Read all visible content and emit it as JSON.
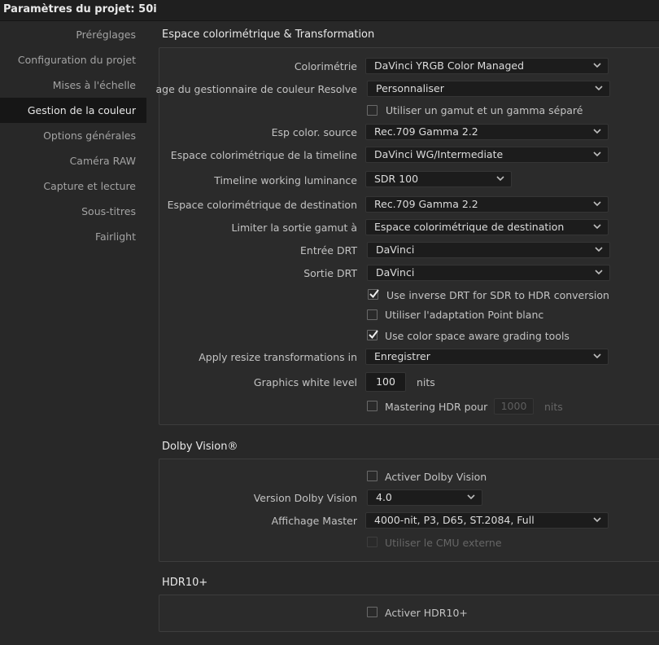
{
  "window": {
    "title": "Paramètres du projet:  50i"
  },
  "sidebar": {
    "items": [
      {
        "label": "Préréglages"
      },
      {
        "label": "Configuration du projet"
      },
      {
        "label": "Mises à l'échelle"
      },
      {
        "label": "Gestion de la couleur"
      },
      {
        "label": "Options générales"
      },
      {
        "label": "Caméra RAW"
      },
      {
        "label": "Capture et lecture"
      },
      {
        "label": "Sous-titres"
      },
      {
        "label": "Fairlight"
      }
    ],
    "active_index": 3
  },
  "color_section": {
    "title": "Espace colorimétrique & Transformation",
    "colorimetrie": {
      "label": "Colorimétrie",
      "value": "DaVinci YRGB Color Managed"
    },
    "preset": {
      "label": "age du gestionnaire de couleur Resolve",
      "value": "Personnaliser"
    },
    "separate_gamut": {
      "label": "Utiliser un gamut et un gamma séparé",
      "checked": false
    },
    "input_space": {
      "label": "Esp color. source",
      "value": "Rec.709 Gamma 2.2"
    },
    "timeline_space": {
      "label": "Espace colorimétrique de la timeline",
      "value": "DaVinci WG/Intermediate"
    },
    "timeline_luminance": {
      "label": "Timeline working luminance",
      "value": "SDR 100"
    },
    "output_space": {
      "label": "Espace colorimétrique de destination",
      "value": "Rec.709 Gamma 2.2"
    },
    "limit_gamut": {
      "label": "Limiter la sortie gamut à",
      "value": "Espace colorimétrique de destination"
    },
    "input_drt": {
      "label": "Entrée DRT",
      "value": "DaVinci"
    },
    "output_drt": {
      "label": "Sortie DRT",
      "value": "DaVinci"
    },
    "inverse_drt": {
      "label": "Use inverse DRT for SDR to HDR conversion",
      "checked": true
    },
    "white_point": {
      "label": "Utiliser l'adaptation Point blanc",
      "checked": false
    },
    "aware_tools": {
      "label": "Use color space aware grading tools",
      "checked": true
    },
    "resize": {
      "label": "Apply resize transformations in",
      "value": "Enregistrer"
    },
    "graphics_white": {
      "label": "Graphics white level",
      "value": "100",
      "unit": "nits"
    },
    "mastering_hdr": {
      "label": "Mastering HDR pour",
      "checked": false,
      "value": "1000",
      "unit": "nits"
    }
  },
  "dolby_section": {
    "title": "Dolby Vision®",
    "enable": {
      "label": "Activer Dolby Vision",
      "checked": false
    },
    "version": {
      "label": "Version Dolby Vision",
      "value": "4.0"
    },
    "master_display": {
      "label": "Affichage Master",
      "value": "4000-nit, P3, D65, ST.2084, Full"
    },
    "external_cmu": {
      "label": "Utiliser le CMU externe",
      "checked": false
    }
  },
  "hdr10_section": {
    "title": "HDR10+",
    "enable": {
      "label": "Activer HDR10+",
      "checked": false
    }
  },
  "colors": {
    "background": "#282828",
    "panel": "#2b2b2b",
    "field": "#1c1c1c",
    "active_nav": "#161616",
    "text": "#c3c3c3"
  }
}
